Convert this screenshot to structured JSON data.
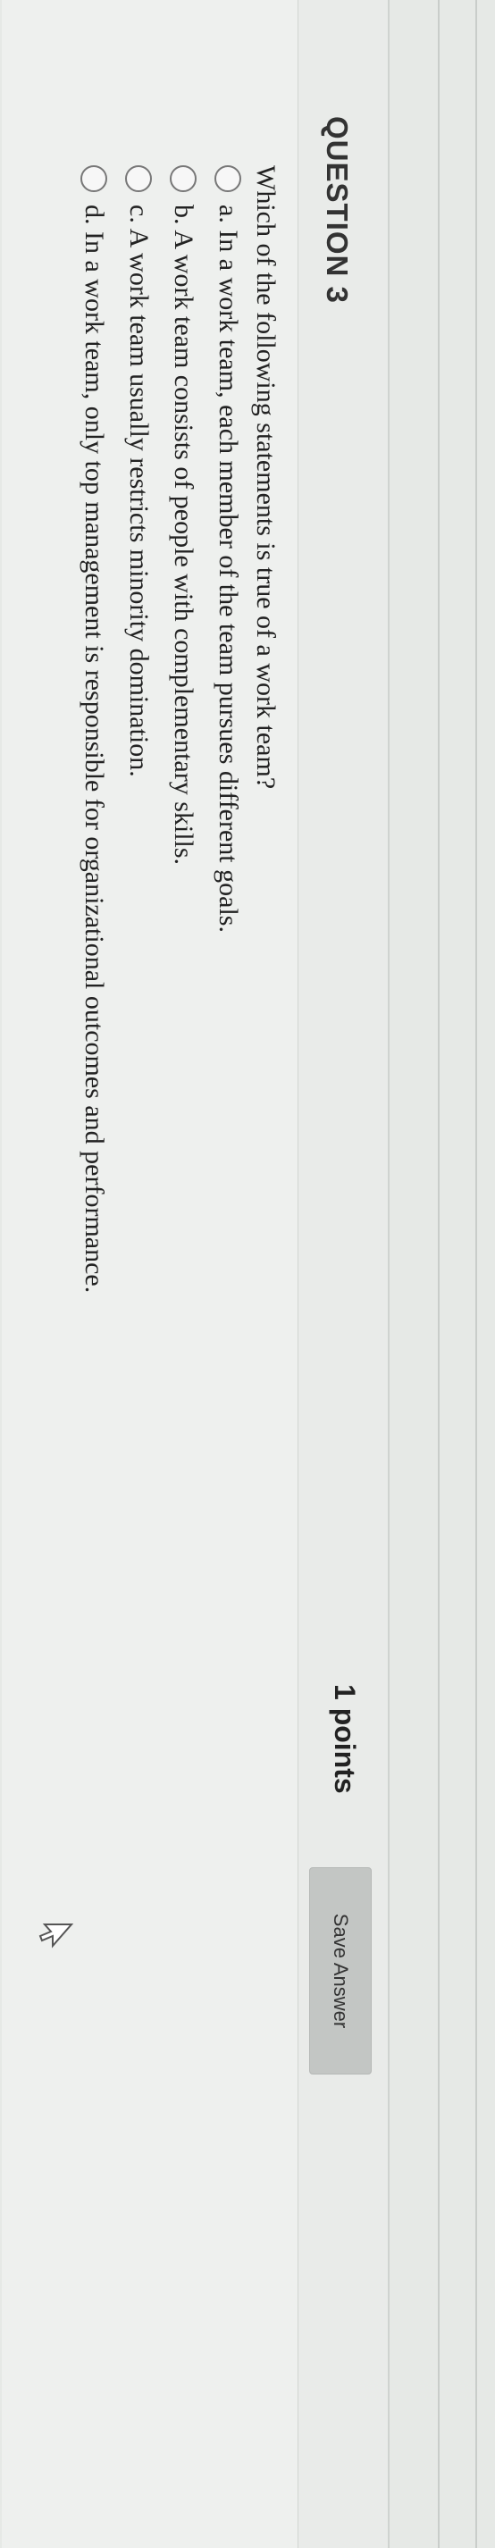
{
  "header": {
    "question_title": "QUESTION 3",
    "points": "1 points",
    "save_label": "Save Answer"
  },
  "question": {
    "text": "Which of the following statements is true of a work team?",
    "options": [
      {
        "label": "a. In a work team, each member of the team pursues different goals."
      },
      {
        "label": "b. A work team consists of people with complementary skills."
      },
      {
        "label": "c. A work team usually restricts minority domination."
      },
      {
        "label": "d. In a work team, only top management is responsible for organizational outcomes and performance."
      }
    ]
  },
  "icons": {
    "cursor": "mouse-pointer-icon",
    "radio": "radio-button-icon"
  }
}
